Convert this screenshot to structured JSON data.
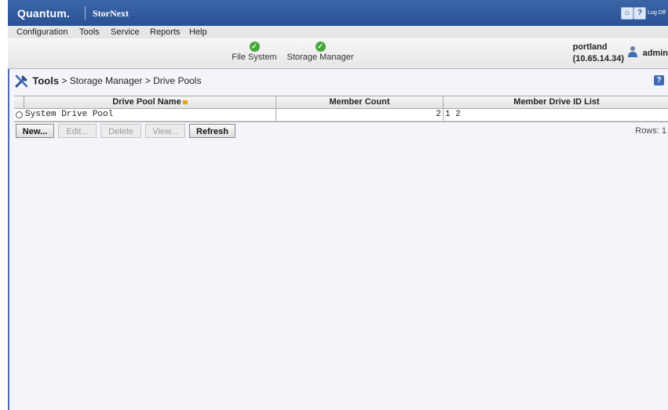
{
  "brand": {
    "logo": "Quantum.",
    "product": "StorNext",
    "logoff_label": "Log Off"
  },
  "menu": [
    "Configuration",
    "Tools",
    "Service",
    "Reports",
    "Help"
  ],
  "status_items": [
    {
      "label": "File System",
      "state": "ok"
    },
    {
      "label": "Storage Manager",
      "state": "ok"
    }
  ],
  "host": {
    "name": "portland",
    "ip": "(10.65.14.34)"
  },
  "user": {
    "name": "admin"
  },
  "breadcrumb": {
    "root": "Tools",
    "rest": " > Storage Manager > Drive Pools"
  },
  "table": {
    "columns": [
      "Drive Pool Name",
      "Member Count",
      "Member Drive ID List"
    ],
    "rows": [
      {
        "name": "System Drive Pool",
        "member_count": "2",
        "member_ids": "1 2"
      }
    ]
  },
  "buttons": [
    {
      "label": "New...",
      "enabled": true
    },
    {
      "label": "Edit...",
      "enabled": false
    },
    {
      "label": "Delete",
      "enabled": false
    },
    {
      "label": "View...",
      "enabled": false
    },
    {
      "label": "Refresh",
      "enabled": true
    }
  ],
  "rows_label": "Rows: 1",
  "colors": {
    "header_blue": "#2a5193",
    "status_ok": "#47a83b",
    "sort_indicator": "#e5a514"
  }
}
